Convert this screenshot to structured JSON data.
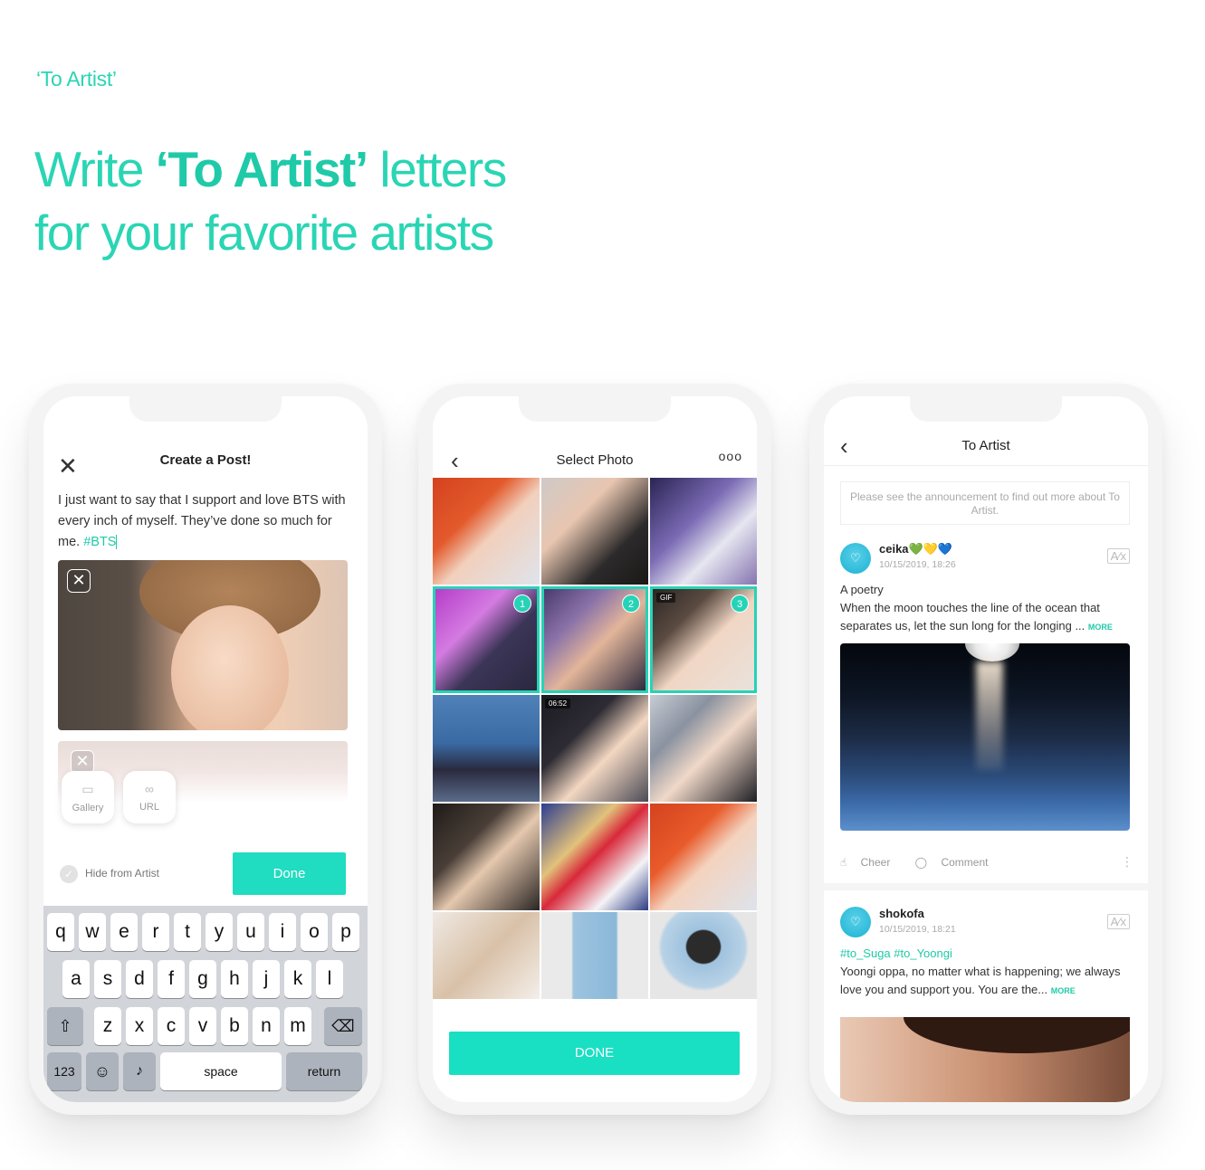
{
  "header": {
    "eyebrow": "‘To Artist’",
    "headline_line1_pre": "Write ",
    "headline_line1_bold": "‘To Artist’",
    "headline_line1_post": " letters",
    "headline_line2": "for your favorite artists",
    "accent_color": "#2ad5b4"
  },
  "create_post": {
    "title": "Create a Post!",
    "close_icon": "close-icon",
    "body_text": "I just want to say that I support and love BTS with every inch of myself. They’ve done so much for me.",
    "hashtag": "#BTS",
    "attach": {
      "gallery_label": "Gallery",
      "url_label": "URL"
    },
    "hide_from_artist_label": "Hide from Artist",
    "done_label": "Done",
    "keyboard": {
      "row1": [
        "q",
        "w",
        "e",
        "r",
        "t",
        "y",
        "u",
        "i",
        "o",
        "p"
      ],
      "row2": [
        "a",
        "s",
        "d",
        "f",
        "g",
        "h",
        "j",
        "k",
        "l"
      ],
      "row3": [
        "z",
        "x",
        "c",
        "v",
        "b",
        "n",
        "m"
      ],
      "numbers_label": "123",
      "space_label": "space",
      "return_label": "return"
    }
  },
  "select_photo": {
    "title": "Select Photo",
    "more_icon": "ooo",
    "selection_numbers": [
      "1",
      "2",
      "3"
    ],
    "gif_label": "GIF",
    "video_duration": "06:52",
    "done_label": "DONE",
    "accent_color": "#19dfc3"
  },
  "to_artist_feed": {
    "title": "To Artist",
    "notice": "Please see the announcement to find out more about To Artist.",
    "posts": [
      {
        "user": "ceika",
        "emojis": "💚💛💙",
        "date": "10/15/2019, 18:26",
        "text_line1": "A poetry",
        "text_body": " When the moon touches the line of the ocean that separates us, let the sun long for the longing ...",
        "more_label": "MORE",
        "cheer_label": "Cheer",
        "comment_label": "Comment"
      },
      {
        "user": "shokofa",
        "date": "10/15/2019, 18:21",
        "tags": "#to_Suga #to_Yoongi",
        "text_body": "Yoongi oppa, no matter what is happening; we always love you and support you. You are the...",
        "more_label": "MORE"
      }
    ]
  }
}
